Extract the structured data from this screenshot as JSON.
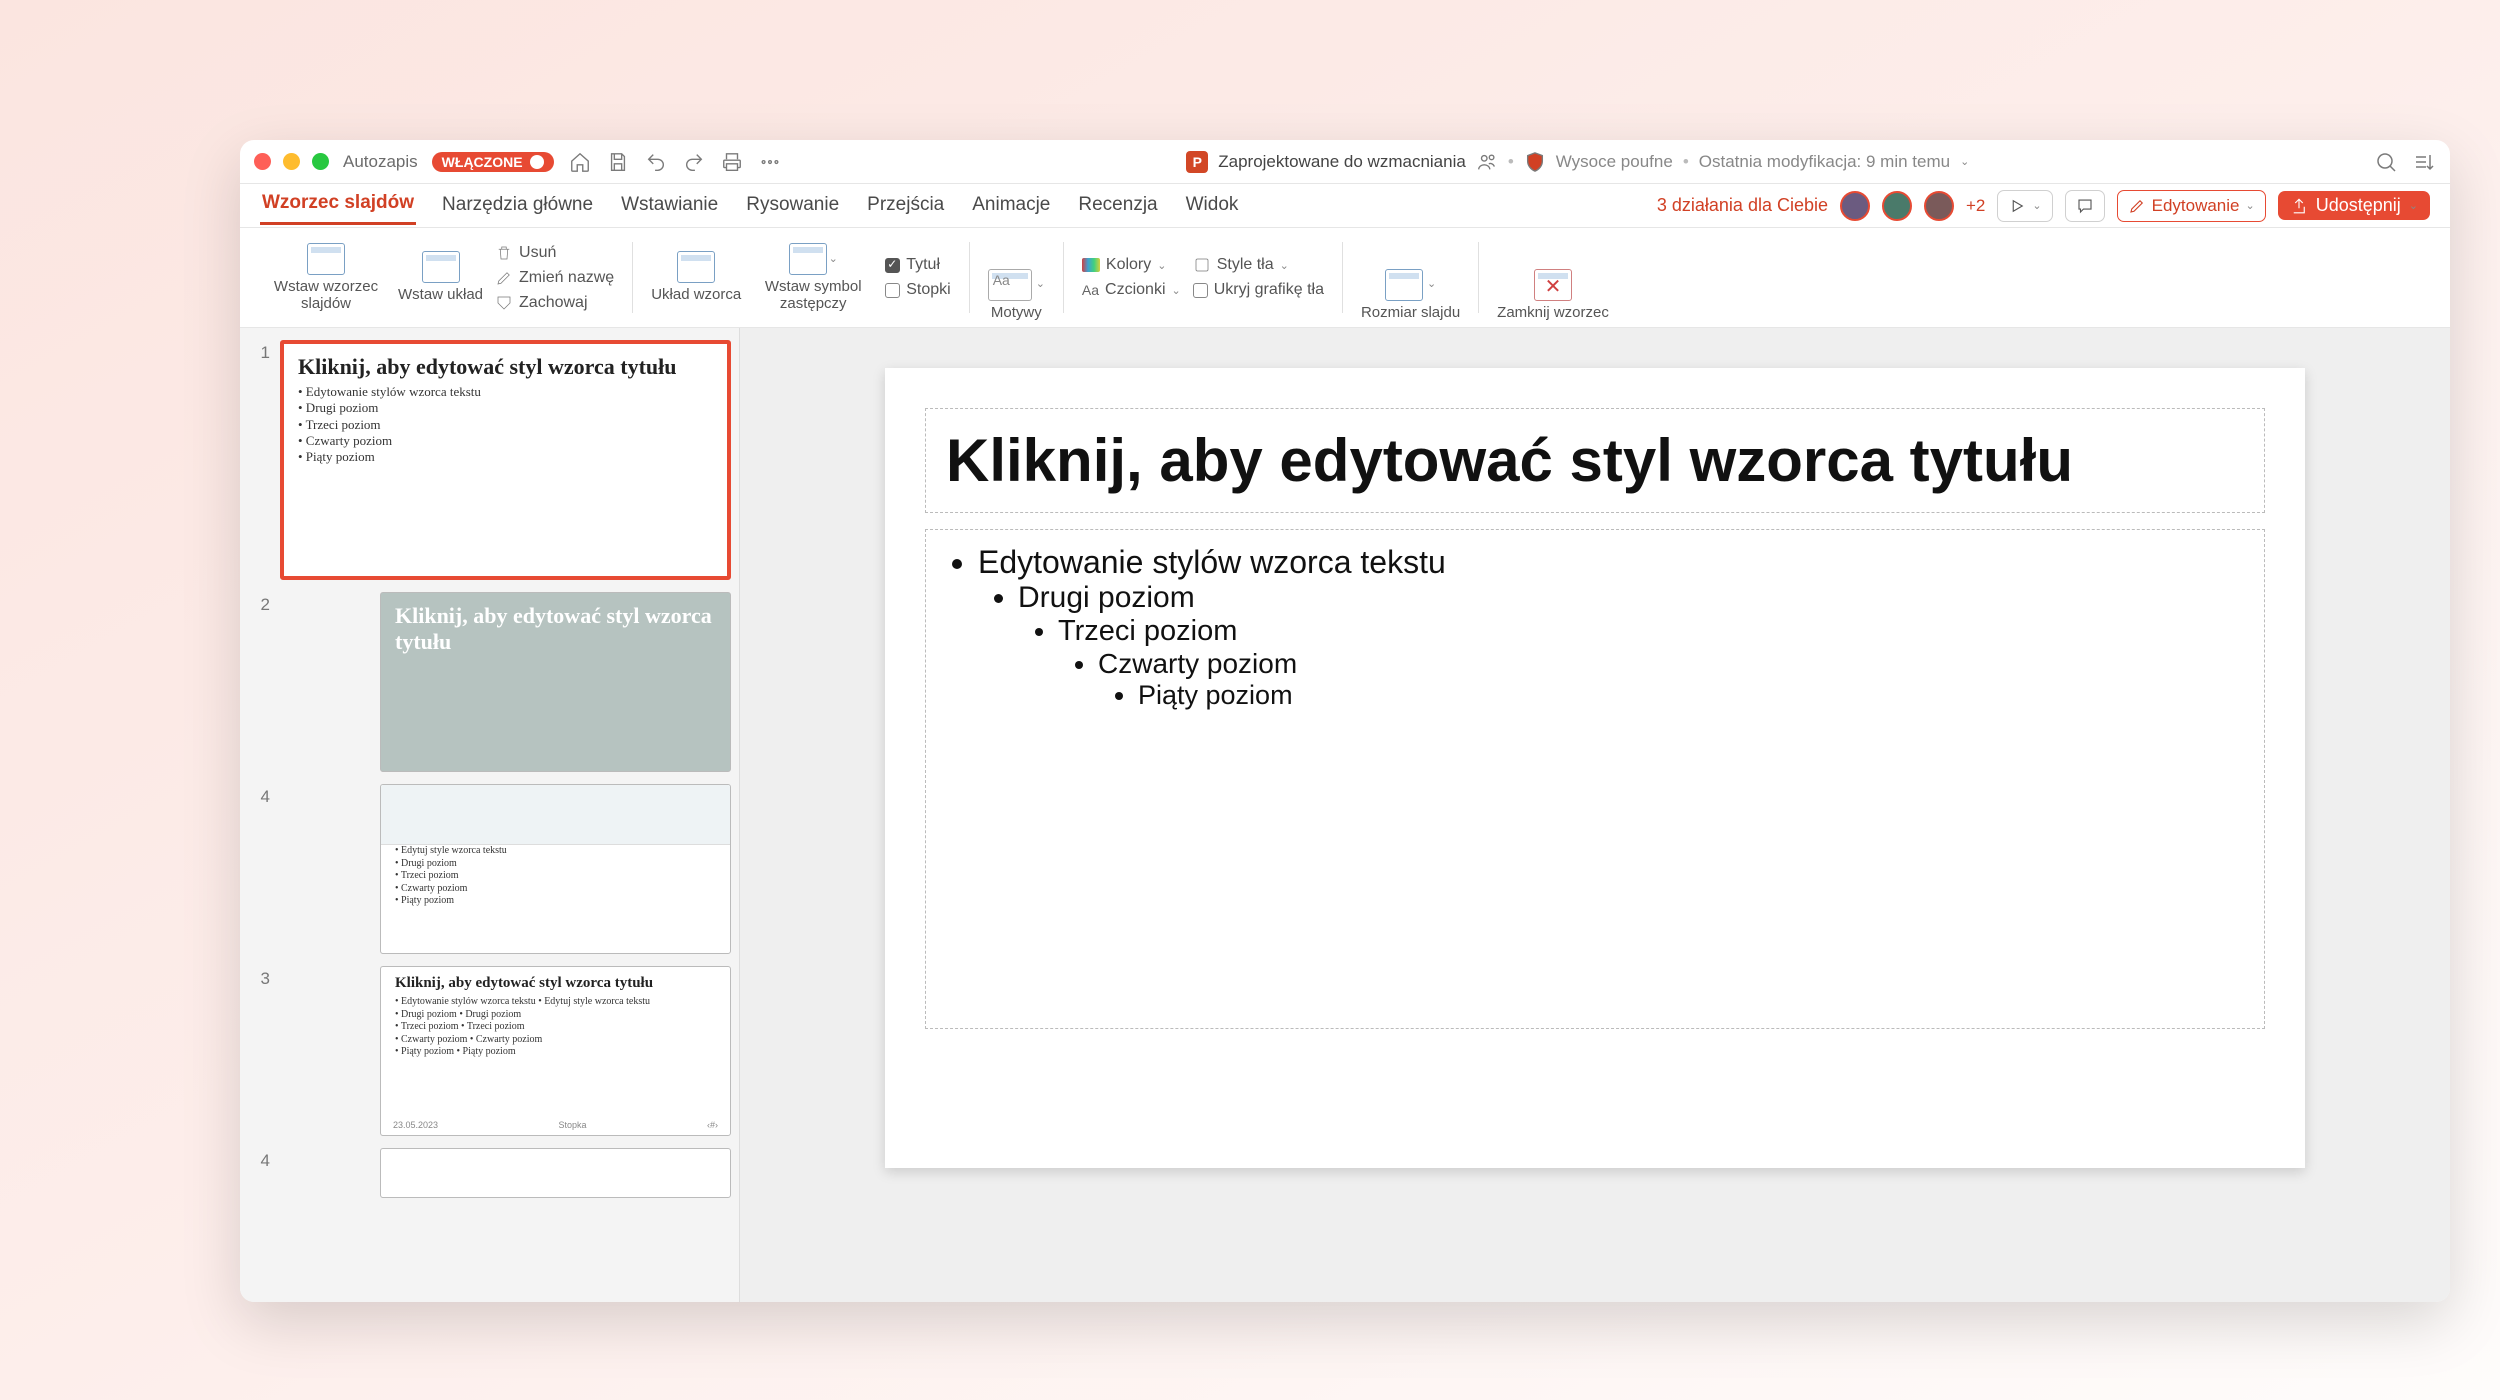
{
  "titlebar": {
    "autosave_label": "Autozapis",
    "autosave_state": "WŁĄCZONE",
    "doc_title": "Zaprojektowane do wzmacniania",
    "sensitivity": "Wysoce poufne",
    "last_mod": "Ostatnia modyfikacja: 9 min temu"
  },
  "tabs": {
    "items": [
      "Wzorzec slajdów",
      "Narzędzia główne",
      "Wstawianie",
      "Rysowanie",
      "Przejścia",
      "Animacje",
      "Recenzja",
      "Widok"
    ],
    "active": 0,
    "actions_for_you": "3 działania dla Ciebie",
    "plus_count": "+2",
    "edit_label": "Edytowanie",
    "share_label": "Udostępnij"
  },
  "ribbon": {
    "insert_master": "Wstaw wzorzec slajdów",
    "insert_layout": "Wstaw układ",
    "delete": "Usuń",
    "rename": "Zmień nazwę",
    "preserve": "Zachowaj",
    "master_layout": "Układ wzorca",
    "placeholder": "Wstaw symbol zastępczy",
    "title_chk": "Tytuł",
    "footers_chk": "Stopki",
    "themes": "Motywy",
    "colors": "Kolory",
    "fonts": "Czcionki",
    "bg_styles": "Style tła",
    "hide_bg": "Ukryj grafikę tła",
    "slide_size": "Rozmiar slajdu",
    "close": "Zamknij wzorzec"
  },
  "thumbs": [
    {
      "num": "1",
      "sel": true,
      "title": "Kliknij, aby edytować styl wzorca tytułu",
      "body": [
        "• Edytowanie stylów wzorca tekstu",
        "  • Drugi poziom",
        "     • Trzeci poziom",
        "        • Czwarty poziom",
        "           • Piąty poziom"
      ]
    },
    {
      "num": "2",
      "indent": true,
      "variant": "dark",
      "title": "Kliknij, aby edytować styl wzorca tytułu",
      "body": []
    },
    {
      "num": "4",
      "indent": true,
      "variant": "two",
      "title": "",
      "body": [
        "• Edytuj style wzorca tekstu",
        "  • Drugi poziom",
        "     • Trzeci poziom",
        "        • Czwarty poziom",
        "           • Piąty poziom"
      ]
    },
    {
      "num": "3",
      "indent": true,
      "variant": "two",
      "title": "Kliknij, aby edytować styl wzorca tytułu",
      "body": [
        "• Edytowanie stylów wzorca tekstu  • Edytuj style wzorca tekstu",
        "  • Drugi poziom        • Drugi poziom",
        "     • Trzeci poziom        • Trzeci poziom",
        "        • Czwarty poziom        • Czwarty poziom",
        "           • Piąty poziom           • Piąty poziom"
      ],
      "footer": [
        "23.05.2023",
        "Stopka",
        "‹#›"
      ]
    },
    {
      "num": "4",
      "indent": true,
      "variant": "blank",
      "title": "",
      "body": []
    }
  ],
  "slide": {
    "title": "Kliknij, aby edytować styl wzorca tytułu",
    "levels": [
      "Edytowanie stylów wzorca tekstu",
      "Drugi poziom",
      "Trzeci poziom",
      "Czwarty poziom",
      "Piąty poziom"
    ]
  }
}
